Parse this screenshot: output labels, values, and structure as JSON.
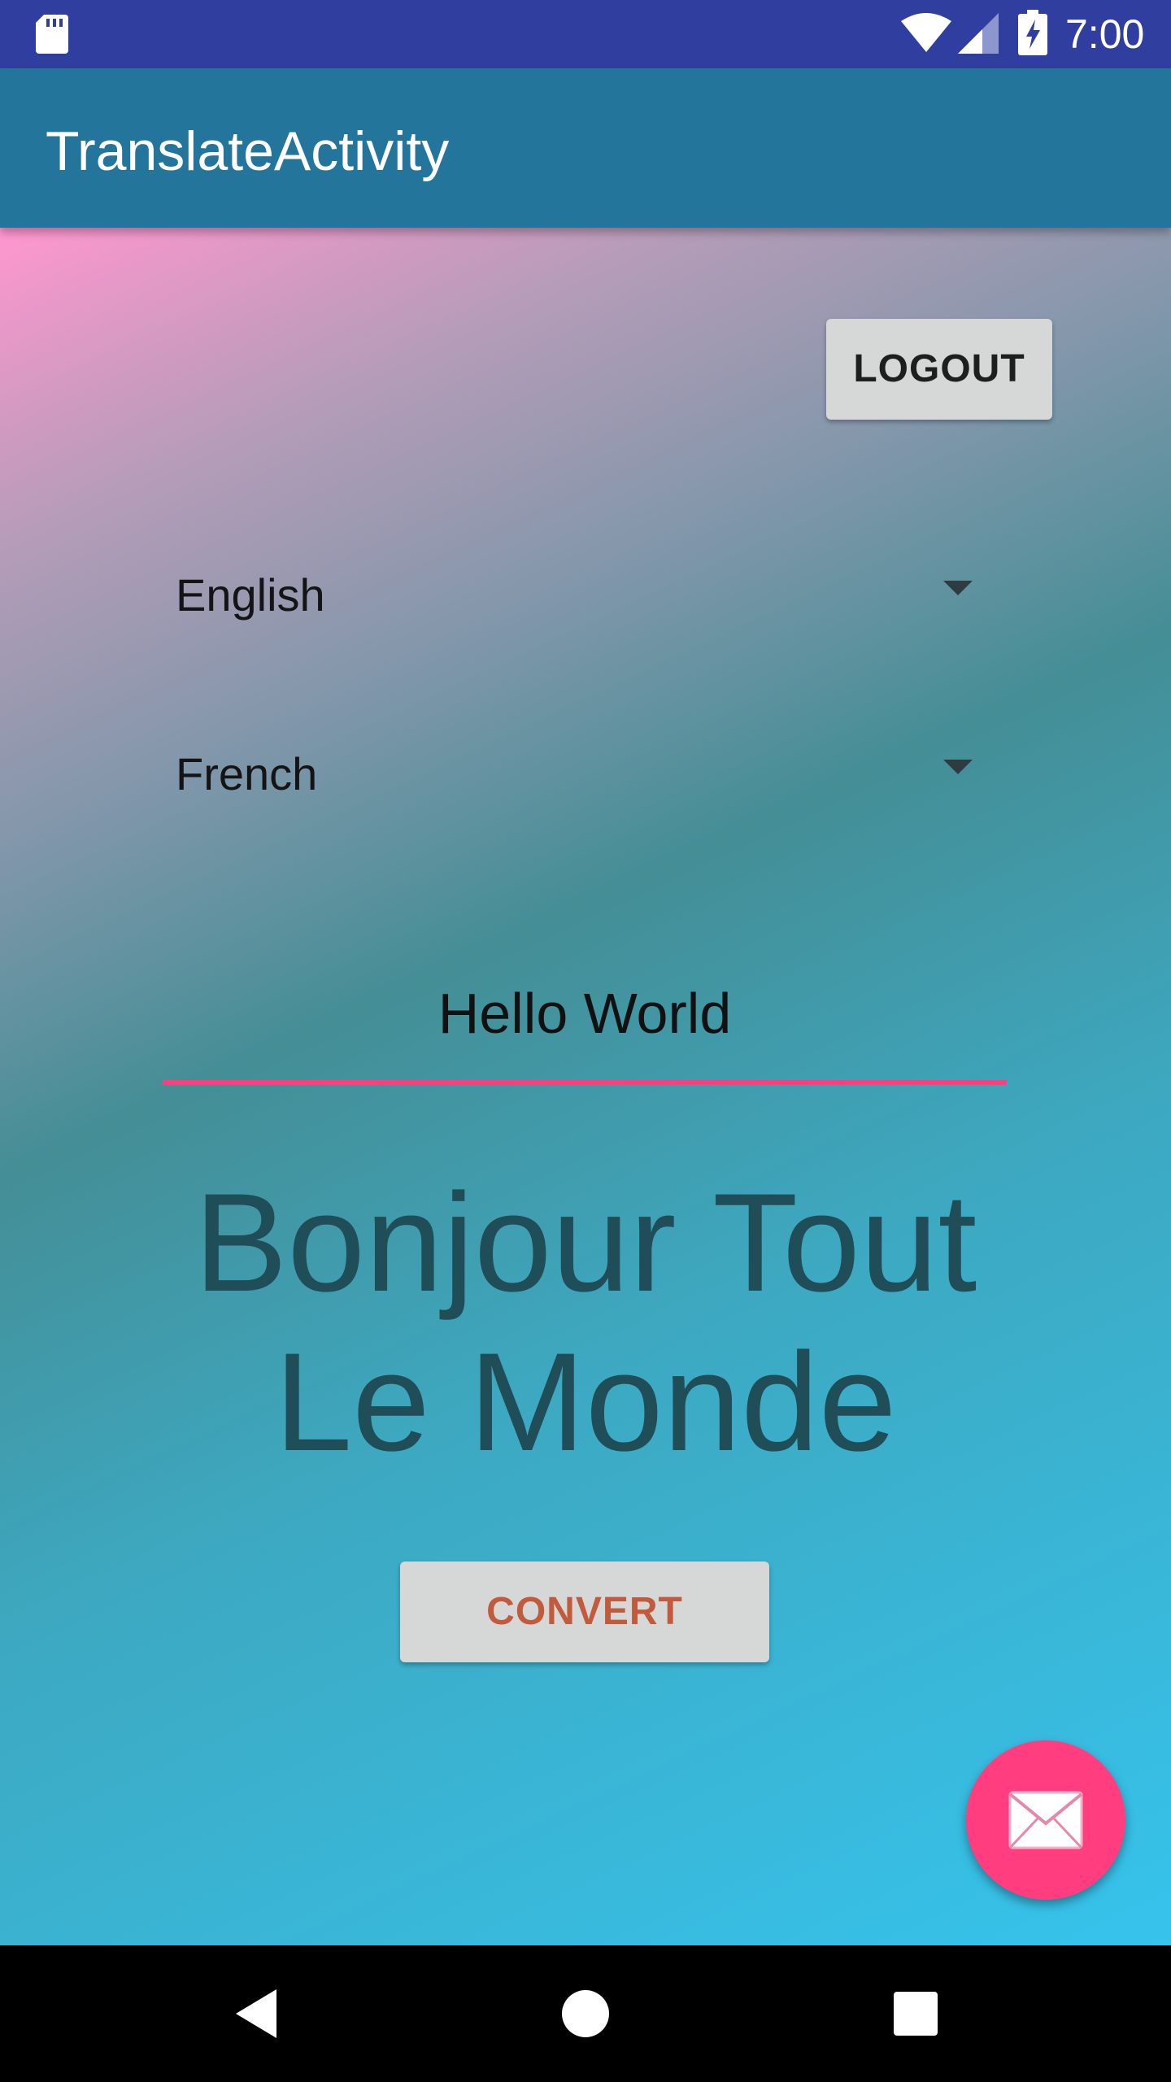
{
  "status_bar": {
    "time": "7:00",
    "icons": [
      "sd-card-icon",
      "wifi-icon",
      "cell-signal-icon",
      "battery-charging-icon"
    ]
  },
  "app_bar": {
    "title": "TranslateActivity",
    "color": "#23759b"
  },
  "main": {
    "logout_label": "LOGOUT",
    "source_language": {
      "selected": "English"
    },
    "target_language": {
      "selected": "French"
    },
    "input_text": "Hello World",
    "output_text": "Bonjour Tout Le Monde",
    "convert_label": "CONVERT",
    "fab_icon": "mail-icon",
    "accent_color": "#ff3d7f"
  },
  "nav_bar": {
    "buttons": [
      "back-icon",
      "home-icon",
      "recents-icon"
    ]
  }
}
